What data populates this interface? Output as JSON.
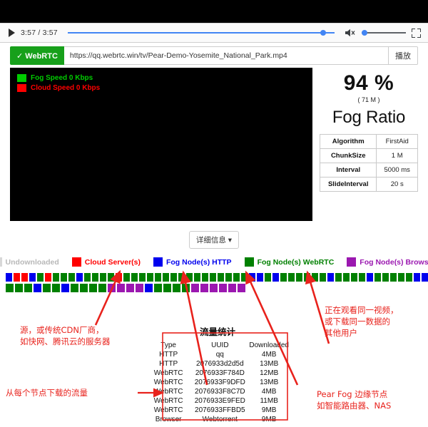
{
  "player": {
    "play_icon": "play-triangle-icon",
    "time": "3:57 / 3:57",
    "mute_icon": "speaker-muted-icon",
    "fullscreen_icon": "fullscreen-icon",
    "seek_label": "video-progress"
  },
  "urlbar": {
    "badge": "✓ WebRTC",
    "url": "https://qq.webrtc.win/tv/Pear-Demo-Yosemite_National_Park.mp4",
    "play_button": "播放"
  },
  "speed_legend": [
    {
      "label": "Fog Speed 0 Kbps",
      "color": "#00cc00"
    },
    {
      "label": "Cloud Speed 0 Kbps",
      "color": "#ff0000"
    }
  ],
  "stats": {
    "percent": "94 %",
    "size": "( 71 M )",
    "label": "Fog Ratio",
    "rows": [
      {
        "key": "Algorithm",
        "value": "FirstAid"
      },
      {
        "key": "ChunkSize",
        "value": "1 M"
      },
      {
        "key": "Interval",
        "value": "5000 ms"
      },
      {
        "key": "SlideInterval",
        "value": "20 s"
      }
    ]
  },
  "detail_button": "详细信息 ▾",
  "node_legend": [
    {
      "label": "Undownloaded",
      "color": "#d8d8d8",
      "text_color": "#b8b8b8"
    },
    {
      "label": "Cloud Server(s)",
      "color": "#ff0000",
      "text_color": "#ff0000"
    },
    {
      "label": "Fog Node(s) HTTP",
      "color": "#0000ee",
      "text_color": "#0000ee"
    },
    {
      "label": "Fog Node(s) WebRTC",
      "color": "#008000",
      "text_color": "#008000"
    },
    {
      "label": "Fog Node(s) Browser",
      "color": "#9b18b0",
      "text_color": "#9b18b0"
    }
  ],
  "chunk_grid": {
    "colors": {
      "undownloaded": "#d8d8d8",
      "cloud": "#ff0000",
      "http": "#0000ee",
      "webrtc": "#008000",
      "browser": "#9b18b0"
    },
    "rows": [
      [
        "http",
        "cloud",
        "cloud",
        "http",
        "webrtc",
        "cloud",
        "webrtc",
        "webrtc",
        "webrtc",
        "http",
        "webrtc",
        "webrtc",
        "webrtc",
        "webrtc",
        "cloud",
        "webrtc",
        "webrtc",
        "webrtc",
        "webrtc",
        "webrtc",
        "webrtc",
        "webrtc",
        "webrtc",
        "webrtc",
        "webrtc",
        "webrtc",
        "webrtc",
        "webrtc",
        "webrtc",
        "webrtc",
        "webrtc",
        "http",
        "http",
        "webrtc",
        "http",
        "webrtc",
        "webrtc",
        "webrtc",
        "webrtc",
        "webrtc",
        "webrtc",
        "http",
        "webrtc",
        "webrtc",
        "webrtc",
        "webrtc",
        "http",
        "webrtc",
        "webrtc",
        "webrtc",
        "webrtc",
        "webrtc",
        "http",
        "http"
      ],
      [
        "webrtc",
        "webrtc",
        "webrtc",
        "http",
        "webrtc",
        "webrtc",
        "http",
        "webrtc",
        "webrtc",
        "webrtc",
        "webrtc",
        "browser",
        "browser",
        "browser",
        "browser",
        "http",
        "webrtc",
        "webrtc",
        "webrtc",
        "webrtc",
        "browser",
        "browser",
        "browser",
        "browser",
        "browser",
        "browser"
      ]
    ]
  },
  "traffic": {
    "title": "流量统计",
    "headers": [
      "Type",
      "UUID",
      "Downloaded"
    ],
    "rows": [
      {
        "type": "HTTP",
        "uuid": "qq",
        "downloaded": "4MB"
      },
      {
        "type": "HTTP",
        "uuid": "2076933d2d5d",
        "downloaded": "13MB"
      },
      {
        "type": "WebRTC",
        "uuid": "2076933F784D",
        "downloaded": "12MB"
      },
      {
        "type": "WebRTC",
        "uuid": "2076933F9DFD",
        "downloaded": "13MB"
      },
      {
        "type": "WebRTC",
        "uuid": "2076933F8C7D",
        "downloaded": "4MB"
      },
      {
        "type": "WebRTC",
        "uuid": "2076933E9FED",
        "downloaded": "11MB"
      },
      {
        "type": "WebRTC",
        "uuid": "2076933FFBD5",
        "downloaded": "9MB"
      },
      {
        "type": "Browser",
        "uuid": "Webtorrent",
        "downloaded": "9MB"
      }
    ]
  },
  "annotations": {
    "cloud_source": "源，或传统CDN厂商，\n如快网、腾讯云的服务器",
    "per_node_traffic": "从每个节点下载的流量",
    "same_video_users": "正在观看同一视频，\n或下载同一数据的\n其他用户",
    "pear_fog_edge": "Pear Fog 边缘节点\n如智能路由器、NAS",
    "color": "#e8221c"
  }
}
